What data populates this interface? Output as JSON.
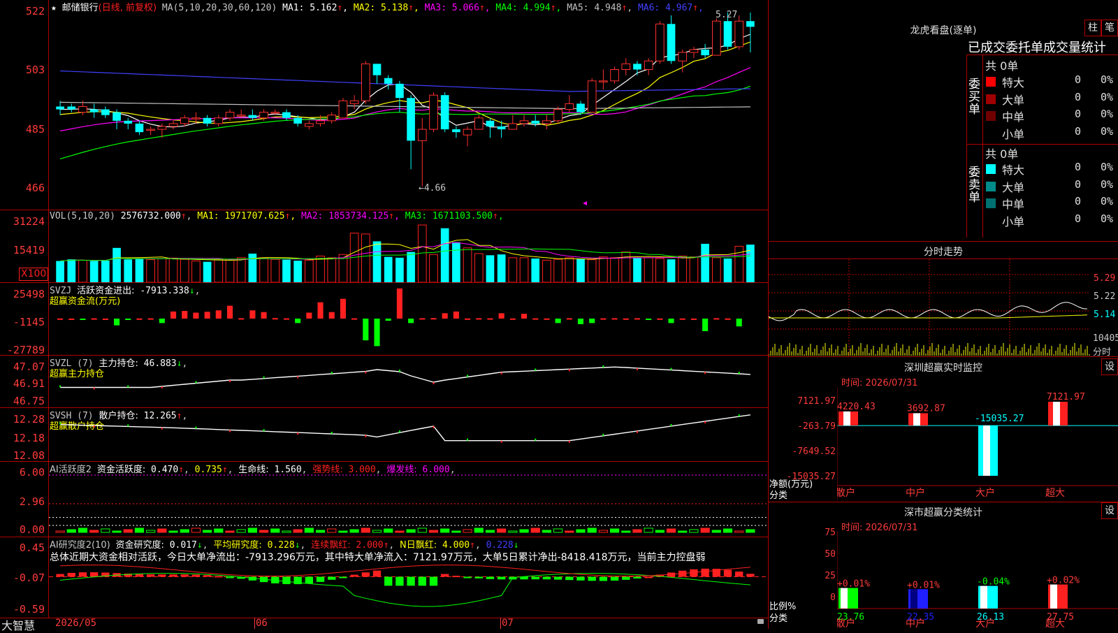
{
  "header": {
    "stock_name": "邮储银行",
    "period_label": "(日线, 前复权)",
    "ma_params": "MA(5,10,20,30,60,120)",
    "ma_values": [
      {
        "label": "MA1:",
        "value": "5.162",
        "arrow": "↑",
        "color": "#ffffff"
      },
      {
        "label": "MA2:",
        "value": "5.138",
        "arrow": "↑",
        "color": "#ffff00"
      },
      {
        "label": "MA3:",
        "value": "5.066",
        "arrow": "↑",
        "color": "#ff00ff"
      },
      {
        "label": "MA4:",
        "value": "4.994",
        "arrow": "↑",
        "color": "#00ff00"
      },
      {
        "label": "MA5:",
        "value": "4.948",
        "arrow": "↑",
        "color": "#c0c0c0"
      },
      {
        "label": "MA6:",
        "value": "4.967",
        "arrow": "↑",
        "color": "#4040ff"
      }
    ]
  },
  "price_axis": {
    "labels": [
      "522",
      "503",
      "485",
      "466"
    ],
    "high_note": "5.27",
    "low_note": "←4.66"
  },
  "vol": {
    "title": "VOL(5,10,20)",
    "value": "2576732.000",
    "arrow": "↑",
    "ma": [
      {
        "label": "MA1:",
        "value": "1971707.625",
        "arrow": "↑",
        "color": "#ffff00"
      },
      {
        "label": "MA2:",
        "value": "1853734.125",
        "arrow": "↑",
        "color": "#ff00ff"
      },
      {
        "label": "MA3:",
        "value": "1671103.500",
        "arrow": "↑",
        "color": "#00ff00"
      }
    ],
    "axis": [
      "31224",
      "15419"
    ],
    "unit": "X100"
  },
  "svzj": {
    "title": "SVZJ",
    "label": "活跃资金进出:",
    "value": "-7913.338",
    "arrow": "↓",
    "sub": "超赢资金流(万元)",
    "axis": [
      "25498",
      "-1145",
      "-27789"
    ]
  },
  "svzl": {
    "title": "SVZL (7)",
    "label": "主力持仓:",
    "value": "46.883",
    "arrow": "↓",
    "sub": "超赢主力持仓",
    "axis": [
      "47.07",
      "46.91",
      "46.75"
    ]
  },
  "svsh": {
    "title": "SVSH (7)",
    "label": "散户持仓:",
    "value": "12.265",
    "arrow": "↑",
    "sub": "超赢散户持仓",
    "axis": [
      "12.28",
      "12.18",
      "12.08"
    ]
  },
  "ai1": {
    "title": "AI活跃度2",
    "label": "资金活跃度:",
    "value": "0.470",
    "a1": "↑",
    "value2": "0.735",
    "a2": "↑",
    "life_label": "生命线:",
    "life_value": "1.560",
    "strong_label": "强势线:",
    "strong_value": "3.000",
    "burst_label": "爆发线:",
    "burst_value": "6.000",
    "axis": [
      "6.00",
      "2.96",
      "0.00"
    ]
  },
  "ai2": {
    "title": "AI研究度2(10)",
    "l1": "资金研究度:",
    "v1": "0.017",
    "a1": "↓",
    "l2": "平均研究度:",
    "v2": "0.228",
    "a2": "↓",
    "l3": "连续飘红:",
    "v3": "2.000",
    "a3": "↑",
    "l4": "N日飘红:",
    "v4": "4.000",
    "a4": "↑",
    "v5": "0.228",
    "a5": "↓",
    "summary": "总体近期大资金相对活跃，今日大单净流出：-7913.296万元，其中特大单净流入：7121.97万元，大单5日累计净出-8418.418万元，当前主力控盘弱",
    "axis": [
      "0.45",
      "-0.07",
      "-0.59"
    ]
  },
  "date_axis": {
    "brand": "大智慧",
    "labels": [
      "2026/05",
      "06",
      "07"
    ]
  },
  "dragon": {
    "title": "龙虎看盘(逐单)",
    "btn1": "柱",
    "btn2": "笔",
    "subtitle": "已成交委托单成交量统计",
    "buy_label": "委买单",
    "sell_label": "委卖单",
    "buy_total": "共 0单",
    "sell_total": "共 0单",
    "buy_rows": [
      {
        "name": "特大",
        "n": "0",
        "pct": "0%",
        "color": "#ff0000"
      },
      {
        "name": "大单",
        "n": "0",
        "pct": "0%",
        "color": "#a00000"
      },
      {
        "name": "中单",
        "n": "0",
        "pct": "0%",
        "color": "#700000"
      },
      {
        "name": "小单",
        "n": "0",
        "pct": "0%",
        "color": ""
      }
    ],
    "sell_rows": [
      {
        "name": "特大",
        "n": "0",
        "pct": "0%",
        "color": "#00ffff"
      },
      {
        "name": "大单",
        "n": "0",
        "pct": "0%",
        "color": "#008b8b"
      },
      {
        "name": "中单",
        "n": "0",
        "pct": "0%",
        "color": "#007070"
      },
      {
        "name": "小单",
        "n": "0",
        "pct": "0%",
        "color": ""
      }
    ]
  },
  "fenshi": {
    "title": "分时走势",
    "axis": [
      "5.29",
      "5.22",
      "5.14"
    ],
    "vol_axis": "10405",
    "unit": "分时"
  },
  "monitor": {
    "title": "深圳超赢实时监控",
    "btn": "设",
    "time_label": "时间: 2026/07/31",
    "axis": [
      "7121.97",
      "-263.79",
      "-7649.52",
      "-15035.27"
    ],
    "ylabel": "净额(万元)",
    "xlabel": "分类",
    "cats": [
      "散户",
      "中户",
      "大户",
      "超大"
    ],
    "values": [
      "4220.43",
      "3692.87",
      "-15035.27",
      "7121.97"
    ]
  },
  "stats": {
    "title": "深市超赢分类统计",
    "btn": "设",
    "time_label": "时间: 2026/07/31",
    "axis": [
      "75",
      "50",
      "25",
      "0"
    ],
    "ylabel": "比例%",
    "xlabel": "分类",
    "cats": [
      "散户",
      "中户",
      "大户",
      "超大"
    ],
    "values": [
      "23.76",
      "22.35",
      "26.13",
      "27.75"
    ],
    "changes": [
      "+0.01%",
      "+0.01%",
      "-0.04%",
      "+0.02%"
    ]
  },
  "chart_data": [
    {
      "type": "candlestick",
      "title": "邮储银行 (日线, 前复权)",
      "ylim": [
        4.6,
        5.27
      ],
      "x_labels": [
        "2026/05",
        "06",
        "07"
      ],
      "candles": [
        [
          4.94,
          4.93,
          4.96,
          4.91
        ],
        [
          4.94,
          4.93,
          4.95,
          4.92
        ],
        [
          4.92,
          4.94,
          4.96,
          4.91
        ],
        [
          4.93,
          4.92,
          4.95,
          4.9
        ],
        [
          4.93,
          4.91,
          4.94,
          4.9
        ],
        [
          4.92,
          4.89,
          4.93,
          4.86
        ],
        [
          4.89,
          4.88,
          4.9,
          4.86
        ],
        [
          4.88,
          4.85,
          4.89,
          4.84
        ],
        [
          4.86,
          4.86,
          4.87,
          4.84
        ],
        [
          4.86,
          4.87,
          4.88,
          4.83
        ],
        [
          4.87,
          4.88,
          4.89,
          4.86
        ],
        [
          4.88,
          4.9,
          4.91,
          4.87
        ],
        [
          4.9,
          4.9,
          4.92,
          4.88
        ],
        [
          4.9,
          4.88,
          4.91,
          4.87
        ],
        [
          4.88,
          4.9,
          4.91,
          4.87
        ],
        [
          4.9,
          4.92,
          4.93,
          4.89
        ],
        [
          4.91,
          4.91,
          4.93,
          4.9
        ],
        [
          4.91,
          4.9,
          4.93,
          4.89
        ],
        [
          4.9,
          4.92,
          4.93,
          4.89
        ],
        [
          4.92,
          4.92,
          4.93,
          4.91
        ],
        [
          4.92,
          4.9,
          4.93,
          4.89
        ],
        [
          4.9,
          4.88,
          4.91,
          4.87
        ],
        [
          4.87,
          4.88,
          4.89,
          4.86
        ],
        [
          4.88,
          4.89,
          4.91,
          4.87
        ],
        [
          4.89,
          4.91,
          4.92,
          4.88
        ],
        [
          4.9,
          4.96,
          4.97,
          4.9
        ],
        [
          4.95,
          4.96,
          4.98,
          4.93
        ],
        [
          4.96,
          5.09,
          5.1,
          4.95
        ],
        [
          5.09,
          5.05,
          5.09,
          5.02
        ],
        [
          5.04,
          5.02,
          5.05,
          5.0
        ],
        [
          5.02,
          4.97,
          5.03,
          4.92
        ],
        [
          4.97,
          4.82,
          4.98,
          4.72
        ],
        [
          4.82,
          4.86,
          4.9,
          4.66
        ],
        [
          4.86,
          4.98,
          4.99,
          4.85
        ],
        [
          4.98,
          4.86,
          4.99,
          4.85
        ],
        [
          4.86,
          4.85,
          4.87,
          4.83
        ],
        [
          4.84,
          4.86,
          4.87,
          4.8
        ],
        [
          4.86,
          4.9,
          4.91,
          4.86
        ],
        [
          4.89,
          4.87,
          4.9,
          4.83
        ],
        [
          4.87,
          4.86,
          4.89,
          4.83
        ],
        [
          4.86,
          4.88,
          4.91,
          4.86
        ],
        [
          4.88,
          4.89,
          4.91,
          4.87
        ],
        [
          4.89,
          4.88,
          4.91,
          4.87
        ],
        [
          4.88,
          4.89,
          4.91,
          4.86
        ],
        [
          4.89,
          4.93,
          4.94,
          4.88
        ],
        [
          4.93,
          4.95,
          4.98,
          4.92
        ],
        [
          4.95,
          4.92,
          4.96,
          4.91
        ],
        [
          4.92,
          5.03,
          5.04,
          4.92
        ],
        [
          5.03,
          5.03,
          5.07,
          5.0
        ],
        [
          5.03,
          5.07,
          5.08,
          5.02
        ],
        [
          5.07,
          5.09,
          5.11,
          5.05
        ],
        [
          5.09,
          5.07,
          5.1,
          5.05
        ],
        [
          5.07,
          5.1,
          5.11,
          5.05
        ],
        [
          5.1,
          5.23,
          5.24,
          5.09
        ],
        [
          5.23,
          5.1,
          5.26,
          5.09
        ],
        [
          5.1,
          5.13,
          5.14,
          5.06
        ],
        [
          5.13,
          5.14,
          5.15,
          5.11
        ],
        [
          5.14,
          5.12,
          5.16,
          5.11
        ],
        [
          5.12,
          5.24,
          5.25,
          5.12
        ],
        [
          5.24,
          5.15,
          5.27,
          5.14
        ],
        [
          5.15,
          5.24,
          5.26,
          5.14
        ],
        [
          5.24,
          5.22,
          5.27,
          5.13
        ]
      ],
      "ma_series": [
        {
          "name": "MA1",
          "color": "#ffffff"
        },
        {
          "name": "MA2",
          "color": "#ffff00"
        },
        {
          "name": "MA3",
          "color": "#ff00ff"
        },
        {
          "name": "MA4",
          "color": "#00ff00"
        },
        {
          "name": "MA5",
          "color": "#c0c0c0"
        },
        {
          "name": "MA6",
          "color": "#4040ff"
        }
      ]
    },
    {
      "type": "bar",
      "title": "VOL(5,10,20)",
      "ylim": [
        0,
        35000
      ],
      "values": [
        13000,
        14000,
        13500,
        13000,
        13200,
        21000,
        14000,
        14200,
        13800,
        14500,
        14800,
        14000,
        13000,
        12500,
        13800,
        14000,
        15000,
        17500,
        15000,
        14000,
        13800,
        13200,
        13500,
        16000,
        15000,
        17000,
        30000,
        29500,
        25000,
        15500,
        15000,
        18500,
        35000,
        17000,
        33000,
        24500,
        21000,
        17500,
        16500,
        17000,
        15000,
        15000,
        14500,
        13500,
        14000,
        15000,
        14500,
        13800,
        15500,
        15000,
        18500,
        15000,
        15000,
        14500,
        14000,
        16000,
        15500,
        23500,
        15000,
        14500,
        22000,
        23000,
        14000,
        15000,
        15500,
        19500,
        25000
      ],
      "colors_up": "#ff2020",
      "colors_down": "#00ffff"
    },
    {
      "type": "bar",
      "title": "SVZJ 活跃资金进出",
      "ylim": [
        -27789,
        25498
      ],
      "values": [
        -1000,
        -1100,
        -1200,
        -900,
        -1100,
        -7000,
        -1200,
        -1000,
        -900,
        -5000,
        5000,
        5500,
        4000,
        4800,
        6000,
        10000,
        -800,
        6000,
        4500,
        -700,
        -900,
        -5000,
        4000,
        13000,
        4500,
        16000,
        -900,
        -20000,
        -25000,
        -3000,
        25000,
        -5000,
        -800,
        -700,
        3500,
        5000,
        -1000,
        -800,
        -900,
        3500,
        -1000,
        3000,
        -900,
        -1000,
        -5000,
        -800,
        -6000,
        -5000,
        -900,
        -800,
        -1000,
        -800,
        -1200,
        -1000,
        -5000,
        -1000,
        -1100,
        -12000,
        -800,
        -1000,
        -7913
      ]
    },
    {
      "type": "line",
      "title": "SVZL 主力持仓",
      "ylim": [
        46.75,
        47.07
      ],
      "last": 46.883
    },
    {
      "type": "line",
      "title": "SVSH 散户持仓",
      "ylim": [
        12.08,
        12.28
      ],
      "last": 12.265
    },
    {
      "type": "bar",
      "title": "AI活跃度2",
      "ylim": [
        0,
        6.0
      ],
      "hlines": [
        1.56,
        3.0,
        6.0
      ]
    },
    {
      "type": "bar",
      "title": "AI研究度2(10)",
      "ylim": [
        -0.59,
        0.45
      ]
    },
    {
      "type": "bar",
      "title": "深圳超赢实时监控",
      "categories": [
        "散户",
        "中户",
        "大户",
        "超大"
      ],
      "values": [
        4220.43,
        3692.87,
        -15035.27,
        7121.97
      ],
      "ylim": [
        -15035.27,
        7121.97
      ]
    },
    {
      "type": "bar",
      "title": "深市超赢分类统计",
      "categories": [
        "散户",
        "中户",
        "大户",
        "超大"
      ],
      "values": [
        23.76,
        22.35,
        26.13,
        27.75
      ],
      "ylim": [
        0,
        75
      ]
    }
  ]
}
